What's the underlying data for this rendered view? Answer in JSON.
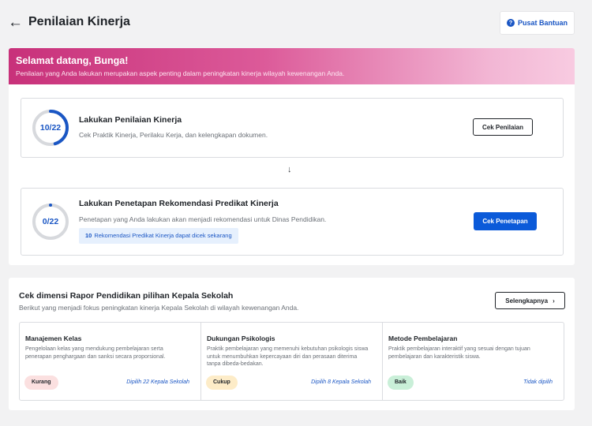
{
  "header": {
    "back_icon": "arrow-left-icon",
    "title": "Penilaian Kinerja",
    "help_label": "Pusat Bantuan",
    "help_icon": "question-circle-icon"
  },
  "banner": {
    "title": "Selamat datang, Bunga!",
    "subtitle": "Penilaian yang Anda lakukan merupakan aspek penting dalam peningkatan kinerja wilayah kewenangan Anda."
  },
  "steps": [
    {
      "progress_label": "10/22",
      "progress_done": 10,
      "progress_total": 22,
      "title": "Lakukan Penilaian Kinerja",
      "description": "Cek Praktik Kinerja, Perilaku Kerja, dan kelengkapan dokumen.",
      "button_label": "Cek Penilaian"
    },
    {
      "progress_label": "0/22",
      "progress_done": 0,
      "progress_total": 22,
      "title": "Lakukan Penetapan Rekomendasi Predikat Kinerja",
      "description": "Penetapan yang Anda lakukan akan menjadi rekomendasi untuk Dinas Pendidikan.",
      "note_count": "10",
      "note_text": "Rekomendasi Predikat Kinerja dapat dicek sekarang",
      "button_label": "Cek Penetapan"
    }
  ],
  "step_arrow_icon": "arrow-down-icon",
  "dimensions": {
    "title": "Cek dimensi Rapor Pendidikan pilihan Kepala Sekolah",
    "subtitle": "Berikut yang menjadi fokus peningkatan kinerja Kepala Sekolah di wilayah kewenangan Anda.",
    "more_label": "Selengkapnya",
    "more_icon": "chevron-right-icon",
    "items": [
      {
        "name": "Manajemen Kelas",
        "description": "Pengelolaan kelas yang mendukung pembelajaran serta penerapan penghargaan dan sanksi secara proporsional.",
        "badge": "Kurang",
        "picked": "Dipilih 22 Kepala Sekolah"
      },
      {
        "name": "Dukungan Psikologis",
        "description": "Praktik pembelajaran yang memenuhi kebutuhan psikologis siswa untuk menumbuhkan kepercayaan diri dan perasaan diterima tanpa dibeda-bedakan.",
        "badge": "Cukup",
        "picked": "Dipilih 8 Kepala Sekolah"
      },
      {
        "name": "Metode Pembelajaran",
        "description": "Praktik pembelajaran interaktif yang sesuai dengan tujuan pembelajaran dan karakteristik siswa.",
        "badge": "Baik",
        "picked": "Tidak dipilih"
      }
    ]
  },
  "colors": {
    "accent": "#0b5ad9",
    "progress": "#1a56c4",
    "track": "#d7d9dd",
    "banner_start": "#c8317a",
    "banner_end": "#f8cbe1"
  }
}
